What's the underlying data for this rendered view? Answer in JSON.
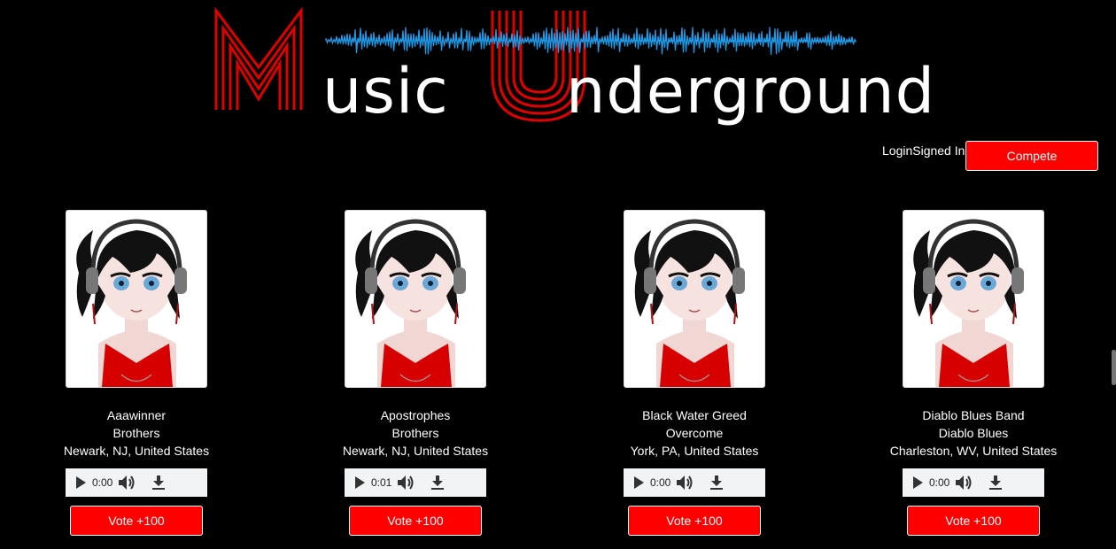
{
  "logo": {
    "word1": "usic",
    "word2": "nderground"
  },
  "header": {
    "auth_text": "LoginSigned In",
    "compete_label": "Compete"
  },
  "colors": {
    "brand_red": "#ff0000",
    "wave_blue": "#1e9be8",
    "background": "#000000"
  },
  "cards": [
    {
      "artist": "Aaawinner",
      "title": "Brothers",
      "location": "Newark, NJ, United States",
      "time": "0:00",
      "vote_label": "Vote +100"
    },
    {
      "artist": "Apostrophes",
      "title": "Brothers",
      "location": "Newark, NJ, United States",
      "time": "0:01",
      "vote_label": "Vote +100"
    },
    {
      "artist": "Black Water Greed",
      "title": "Overcome",
      "location": "York, PA, United States",
      "time": "0:00",
      "vote_label": "Vote +100"
    },
    {
      "artist": "Diablo Blues Band",
      "title": "Diablo Blues",
      "location": "Charleston, WV, United States",
      "time": "0:00",
      "vote_label": "Vote +100"
    }
  ],
  "icons": {
    "play": "play-icon",
    "volume": "volume-icon",
    "download": "download-icon"
  }
}
